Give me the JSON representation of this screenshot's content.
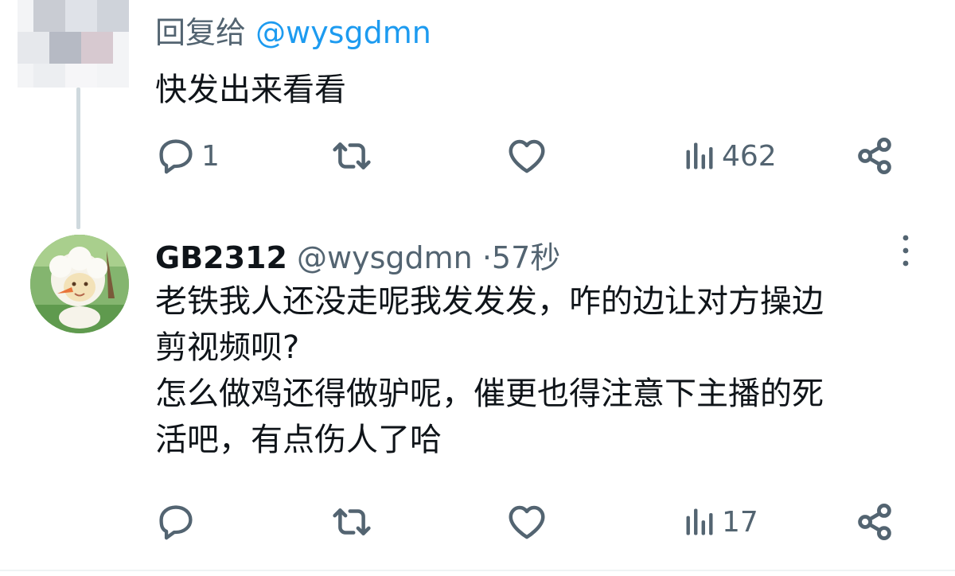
{
  "tweet1": {
    "reply_prefix": "回复给",
    "reply_mention": "@wysgdmn",
    "text": "快发出来看看",
    "actions": {
      "reply_count": "1",
      "retweet_count": "",
      "like_count": "",
      "views_count": "462"
    }
  },
  "tweet2": {
    "display_name": "GB2312",
    "handle": "@wysgdmn",
    "separator": "·",
    "time": "57秒",
    "lines": [
      "老铁我人还没走呢我发发发，咋的边让对方操边",
      "剪视频呗?",
      "怎么做鸡还得做驴呢，催更也得注意下主播的死",
      "活吧，有点伤人了哈"
    ],
    "actions": {
      "reply_count": "",
      "retweet_count": "",
      "like_count": "",
      "views_count": "17"
    }
  },
  "icons": {
    "reply": "reply-icon",
    "retweet": "retweet-icon",
    "like": "heart-icon",
    "views": "views-bar-chart-icon",
    "share": "share-icon",
    "more": "more-vertical-icon"
  },
  "colors": {
    "text": "#0f1419",
    "secondary": "#536471",
    "mention": "#1d9bf0",
    "thread_line": "#cfd9de"
  }
}
